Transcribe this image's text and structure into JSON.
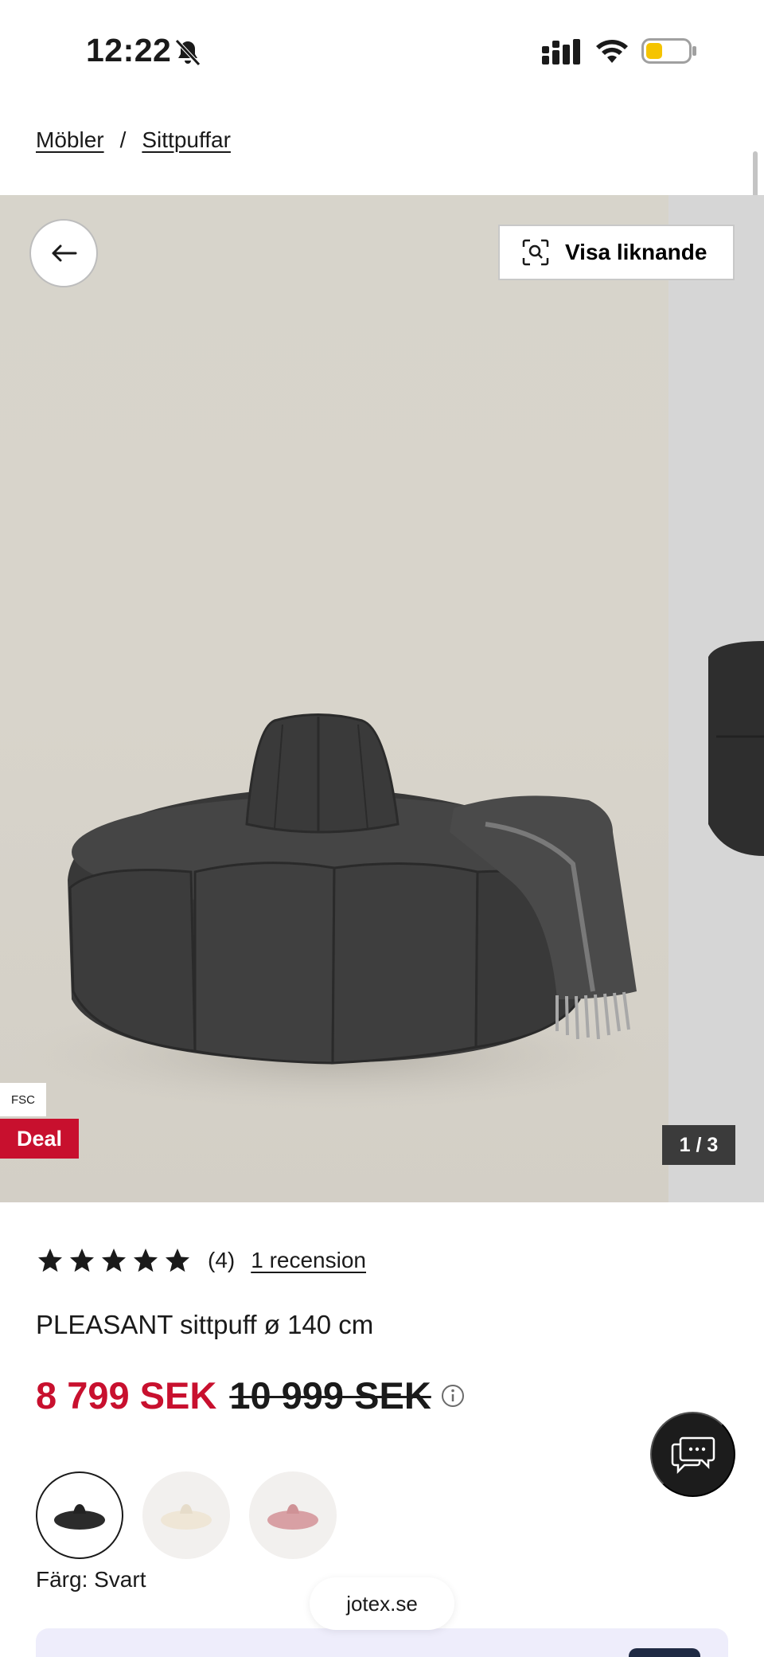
{
  "status_bar": {
    "time": "12:22",
    "icons": [
      "bell-off-icon",
      "signal-icon",
      "wifi-icon",
      "battery-icon"
    ],
    "battery_color": "#f5c400"
  },
  "breadcrumb": {
    "items": [
      "Möbler",
      "Sittpuffar"
    ],
    "separator": "/"
  },
  "gallery": {
    "visa_label": "Visa liknande",
    "fsc_label": "FSC",
    "deal_label": "Deal",
    "counter": "1 / 3",
    "icons": [
      "arrow-left-icon",
      "visual-search-icon"
    ]
  },
  "product": {
    "rating_value": 5,
    "rating_max": 5,
    "rating_count": "(4)",
    "review_link": "1 recension",
    "title": "PLEASANT sittpuff ø 140 cm",
    "price_now": "8 799 SEK",
    "price_old": "10 999 SEK",
    "price_color": "#c8102e",
    "color_label": "Färg: Svart",
    "swatches": [
      "black",
      "cream",
      "pink"
    ]
  },
  "footer": {
    "site": "jotex.se"
  },
  "colors": {
    "deal": "#c8102e",
    "chat_bg": "#1c1c1c",
    "panel_bg": "#eeedfb"
  }
}
